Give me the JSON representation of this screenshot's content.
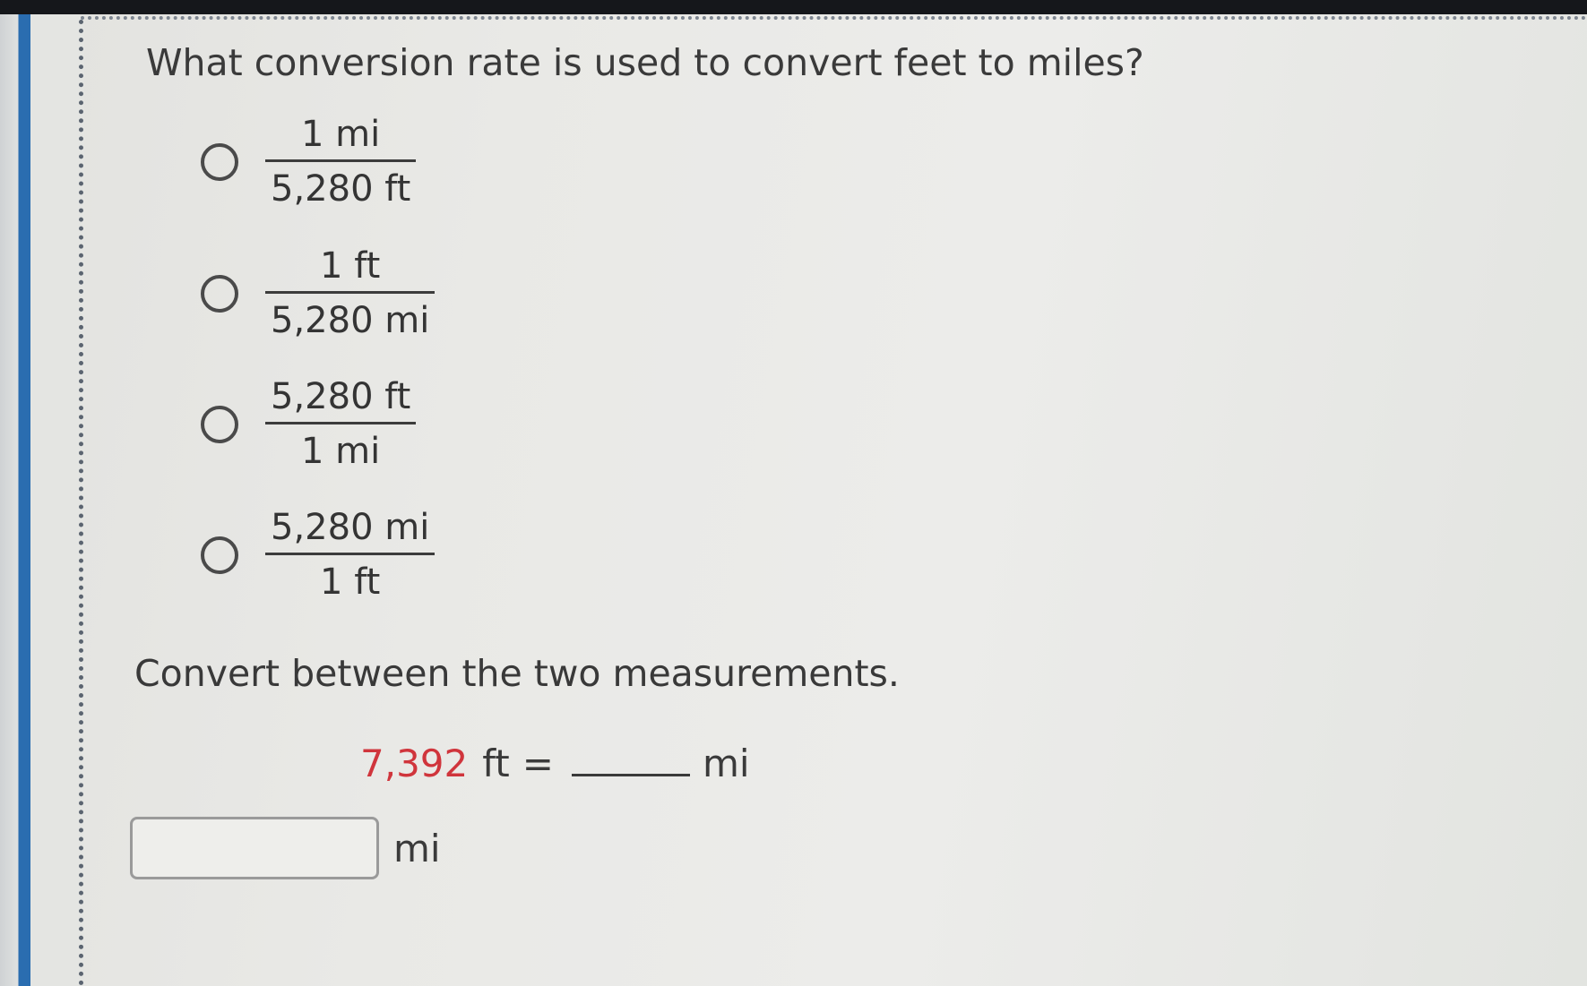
{
  "question": {
    "text": "What conversion rate is used to convert feet to miles?"
  },
  "options": [
    {
      "numerator": "1 mi",
      "denominator": "5,280 ft"
    },
    {
      "numerator": "1 ft",
      "denominator": "5,280 mi"
    },
    {
      "numerator": "5,280 ft",
      "denominator": "1 mi"
    },
    {
      "numerator": "5,280 mi",
      "denominator": "1 ft"
    }
  ],
  "conversion": {
    "instruction": "Convert between the two measurements.",
    "given_value": "7,392",
    "given_unit": "ft",
    "equals": "=",
    "target_unit": "mi",
    "answer_value": "",
    "answer_unit": "mi"
  },
  "colors": {
    "given_value": "#d0353c",
    "accent_bar": "#2a6db0"
  }
}
